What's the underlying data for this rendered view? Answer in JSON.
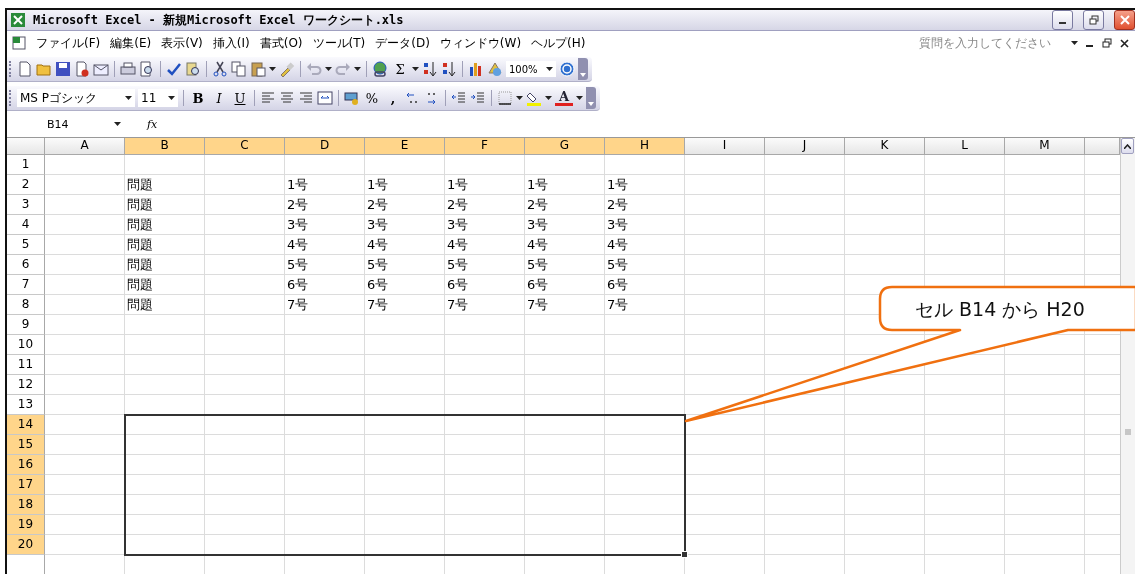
{
  "window": {
    "title": "Microsoft Excel - 新規Microsoft Excel ワークシート.xls"
  },
  "menu": [
    "ファイル(F)",
    "編集(E)",
    "表示(V)",
    "挿入(I)",
    "書式(O)",
    "ツール(T)",
    "データ(D)",
    "ウィンドウ(W)",
    "ヘルプ(H)"
  ],
  "help_box": {
    "placeholder": "質問を入力してください"
  },
  "standard_toolbar": {
    "sum_symbol": "Σ",
    "zoom": "100%"
  },
  "formatting_toolbar": {
    "font": "MS Pゴシック",
    "size": "11",
    "bold": "B",
    "italic": "I",
    "underline": "U",
    "percent": "%",
    "comma": ",",
    "font_color_letter": "A"
  },
  "formula_bar": {
    "name_box": "B14",
    "fx": "fx"
  },
  "sheet": {
    "columns": [
      {
        "label": "A",
        "selected": false
      },
      {
        "label": "B",
        "selected": true
      },
      {
        "label": "C",
        "selected": true
      },
      {
        "label": "D",
        "selected": true
      },
      {
        "label": "E",
        "selected": true
      },
      {
        "label": "F",
        "selected": true
      },
      {
        "label": "G",
        "selected": true
      },
      {
        "label": "H",
        "selected": true
      },
      {
        "label": "I",
        "selected": false
      },
      {
        "label": "J",
        "selected": false
      },
      {
        "label": "K",
        "selected": false
      },
      {
        "label": "L",
        "selected": false
      },
      {
        "label": "M",
        "selected": false
      }
    ],
    "rows": [
      {
        "label": "1",
        "selected": false,
        "cells": {}
      },
      {
        "label": "2",
        "selected": false,
        "cells": {
          "B": "問題",
          "D": "1号",
          "E": "1号",
          "F": "1号",
          "G": "1号",
          "H": "1号"
        }
      },
      {
        "label": "3",
        "selected": false,
        "cells": {
          "B": "問題",
          "D": "2号",
          "E": "2号",
          "F": "2号",
          "G": "2号",
          "H": "2号"
        }
      },
      {
        "label": "4",
        "selected": false,
        "cells": {
          "B": "問題",
          "D": "3号",
          "E": "3号",
          "F": "3号",
          "G": "3号",
          "H": "3号"
        }
      },
      {
        "label": "5",
        "selected": false,
        "cells": {
          "B": "問題",
          "D": "4号",
          "E": "4号",
          "F": "4号",
          "G": "4号",
          "H": "4号"
        }
      },
      {
        "label": "6",
        "selected": false,
        "cells": {
          "B": "問題",
          "D": "5号",
          "E": "5号",
          "F": "5号",
          "G": "5号",
          "H": "5号"
        }
      },
      {
        "label": "7",
        "selected": false,
        "cells": {
          "B": "問題",
          "D": "6号",
          "E": "6号",
          "F": "6号",
          "G": "6号",
          "H": "6号"
        }
      },
      {
        "label": "8",
        "selected": false,
        "cells": {
          "B": "問題",
          "D": "7号",
          "E": "7号",
          "F": "7号",
          "G": "7号",
          "H": "7号"
        }
      },
      {
        "label": "9",
        "selected": false,
        "cells": {}
      },
      {
        "label": "10",
        "selected": false,
        "cells": {}
      },
      {
        "label": "11",
        "selected": false,
        "cells": {}
      },
      {
        "label": "12",
        "selected": false,
        "cells": {}
      },
      {
        "label": "13",
        "selected": false,
        "cells": {}
      },
      {
        "label": "14",
        "selected": true,
        "cells": {}
      },
      {
        "label": "15",
        "selected": true,
        "cells": {}
      },
      {
        "label": "16",
        "selected": true,
        "cells": {}
      },
      {
        "label": "17",
        "selected": true,
        "cells": {}
      },
      {
        "label": "18",
        "selected": true,
        "cells": {}
      },
      {
        "label": "19",
        "selected": true,
        "cells": {}
      },
      {
        "label": "20",
        "selected": true,
        "cells": {}
      }
    ]
  },
  "callout": {
    "text": "セル B14 から H20"
  }
}
